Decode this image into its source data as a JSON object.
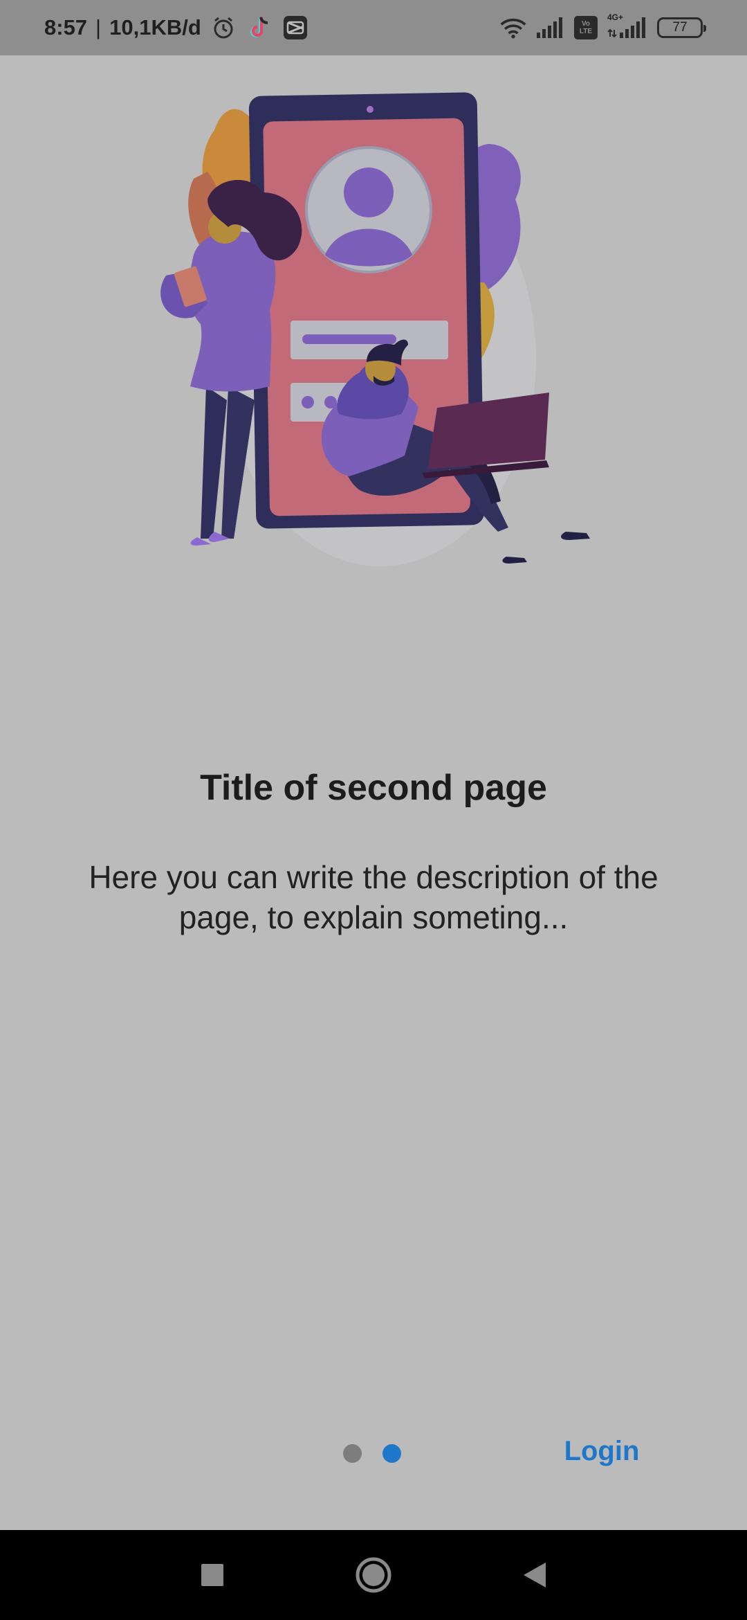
{
  "status_bar": {
    "time": "8:57",
    "separator": "|",
    "speed": "10,1KB/d",
    "icons": [
      "alarm-icon",
      "tiktok-icon",
      "capcut-icon",
      "wifi-icon",
      "signal-icon",
      "volte-icon",
      "signal-4g-icon",
      "battery-icon"
    ],
    "volte_line1": "Vo",
    "volte_line2": "LTE",
    "network_label": "4G+",
    "battery_level": "77"
  },
  "onboarding": {
    "title": "Title of second page",
    "description": "Here you can write the description of the page, to explain someting...",
    "page_count": 2,
    "current_page": 2,
    "login_label": "Login"
  },
  "nav": {
    "icons": [
      "recent-apps-icon",
      "home-icon",
      "back-icon"
    ]
  },
  "colors": {
    "accent": "#1e77c8",
    "background": "#bbbbbb",
    "status_bar": "#8e8e8e"
  }
}
